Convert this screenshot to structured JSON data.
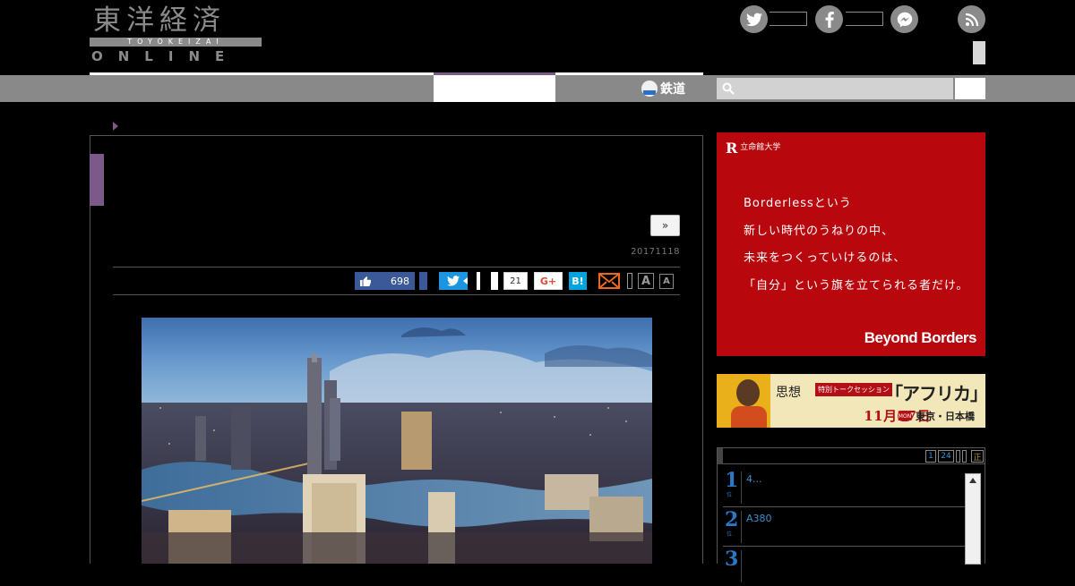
{
  "header": {
    "logo_kanji": "東洋経済",
    "logo_roman": "TOYOKEIZAI",
    "logo_online": "ONLINE"
  },
  "social_icons": [
    "twitter-icon",
    "facebook-icon",
    "messenger-icon",
    "rss-icon"
  ],
  "nav": {
    "rail_label": "鉄道",
    "search_placeholder": ""
  },
  "article": {
    "more_label": "»",
    "date": "20171118",
    "share": {
      "facebook_count": "698",
      "pocket_count": "21",
      "gplus_label": "G+",
      "hatena_label": "B!",
      "font_large": "A",
      "font_small": "A"
    },
    "photo_alt": ""
  },
  "ad_ritsumeikan": {
    "university": "立命館大学",
    "lines": [
      "Borderlessという",
      "新しい時代のうねりの中、",
      "未来をつくっていけるのは、",
      "「自分」という旗を立てられる者だけ。"
    ],
    "slogan": "Beyond Borders"
  },
  "ad_africa": {
    "thought": "思想",
    "pill": "特別トークセッション",
    "title": "「アフリカ」",
    "date": "11月27日",
    "weekday": "MON",
    "place": "東京・日本橋"
  },
  "ranking": {
    "pages": [
      "1",
      "24"
    ],
    "extra_label": "正",
    "items": [
      {
        "rank": "1",
        "sub": "位",
        "title": "4..."
      },
      {
        "rank": "2",
        "sub": "位",
        "title": "A380"
      },
      {
        "rank": "3",
        "sub": "位",
        "title": ""
      }
    ]
  },
  "colors": {
    "accent_purple": "#7b5a8a",
    "nav_gray": "#898989",
    "facebook": "#3b5998",
    "twitter": "#1b95e0",
    "hatena": "#00a4de",
    "ad_red": "#b8080e"
  }
}
